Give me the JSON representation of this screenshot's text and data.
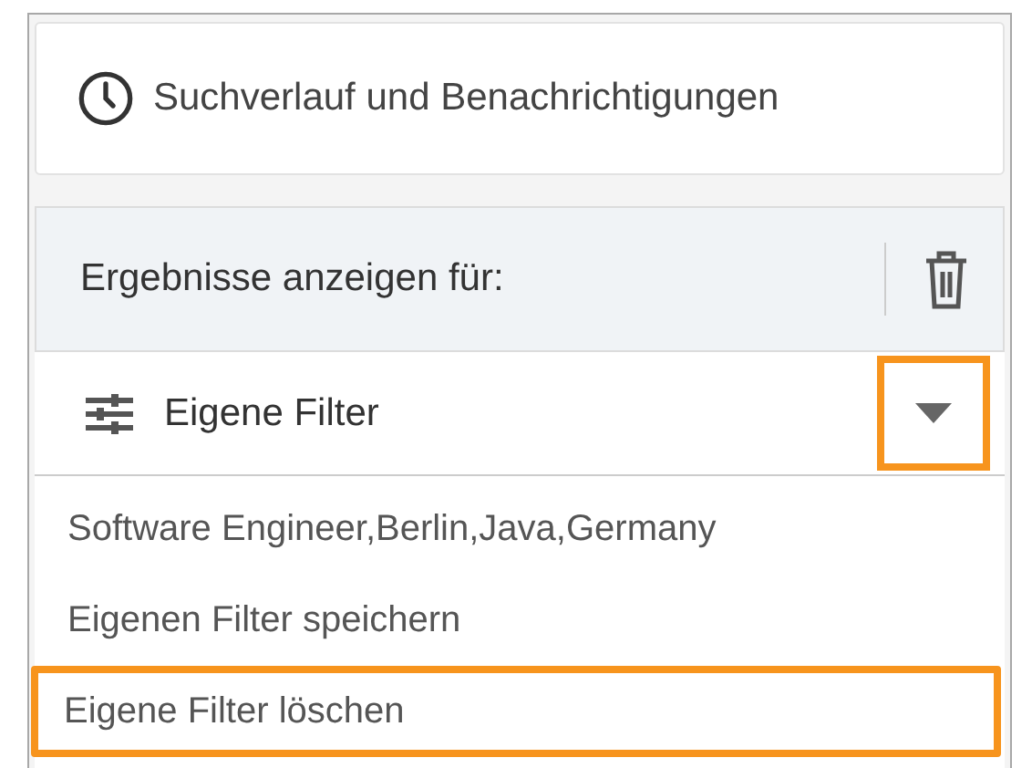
{
  "history_button": {
    "label": "Suchverlauf und Benachrichtigungen"
  },
  "results": {
    "heading": "Ergebnisse anzeigen für:"
  },
  "filter_select": {
    "value": "Eigene Filter",
    "expanded": true,
    "toggle_highlighted": true
  },
  "menu_items": [
    {
      "label": "Software Engineer,Berlin,Java,Germany",
      "highlighted": false
    },
    {
      "label": "Eigenen Filter speichern",
      "highlighted": false
    },
    {
      "label": "Eigene Filter löschen",
      "highlighted": true
    }
  ]
}
